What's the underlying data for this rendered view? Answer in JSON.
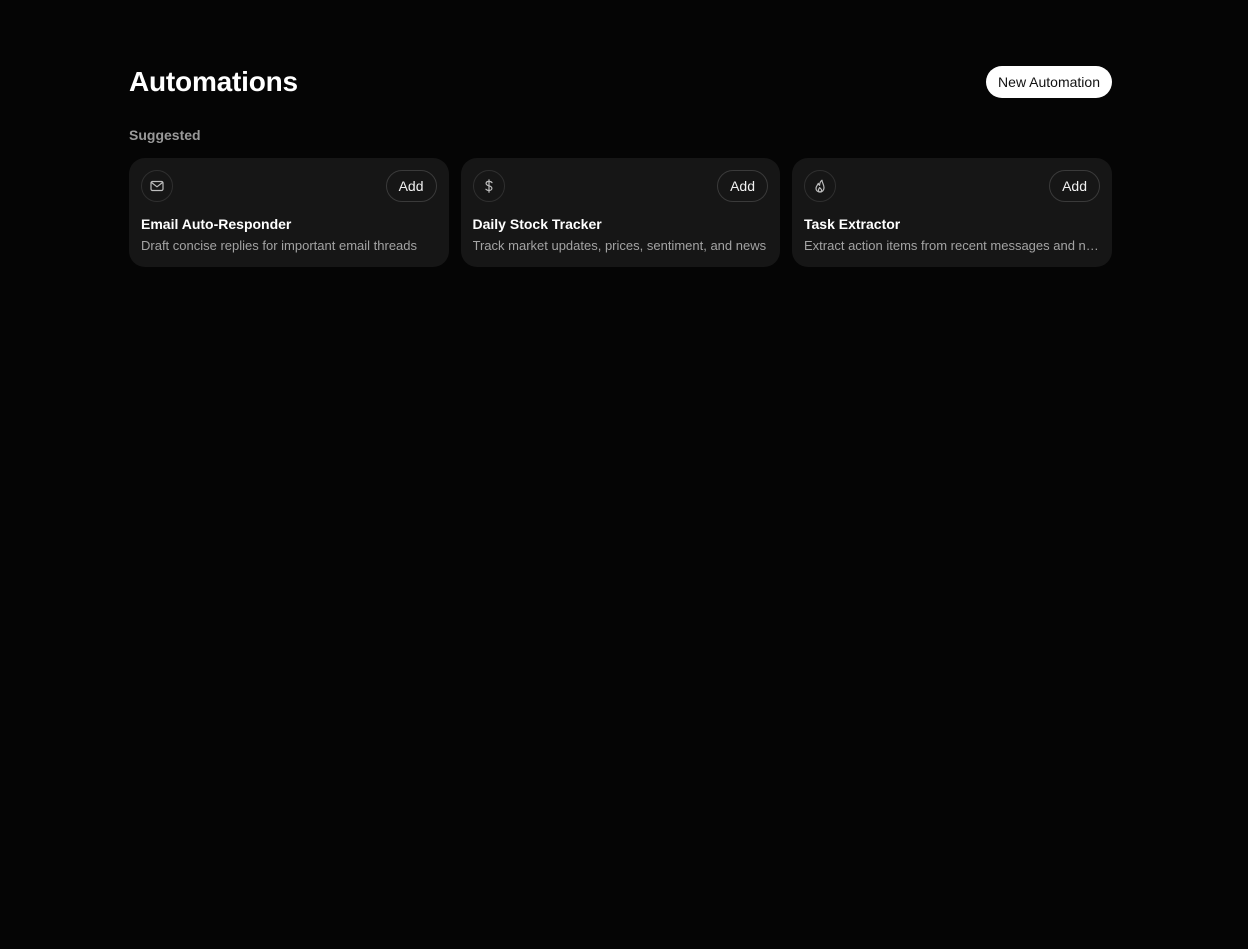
{
  "header": {
    "title": "Automations",
    "new_button_label": "New Automation"
  },
  "suggested": {
    "label": "Suggested",
    "cards": [
      {
        "icon": "mail-icon",
        "title": "Email Auto-Responder",
        "description": "Draft concise replies for important email threads",
        "add_label": "Add"
      },
      {
        "icon": "dollar-icon",
        "title": "Daily Stock Tracker",
        "description": "Track market updates, prices, sentiment, and news",
        "add_label": "Add"
      },
      {
        "icon": "flame-icon",
        "title": "Task Extractor",
        "description": "Extract action items from recent messages and notes",
        "add_label": "Add"
      }
    ]
  },
  "colors": {
    "background": "#050505",
    "card_background": "#161616",
    "primary_button": "#ffffff",
    "muted_text": "#a3a3a3"
  }
}
